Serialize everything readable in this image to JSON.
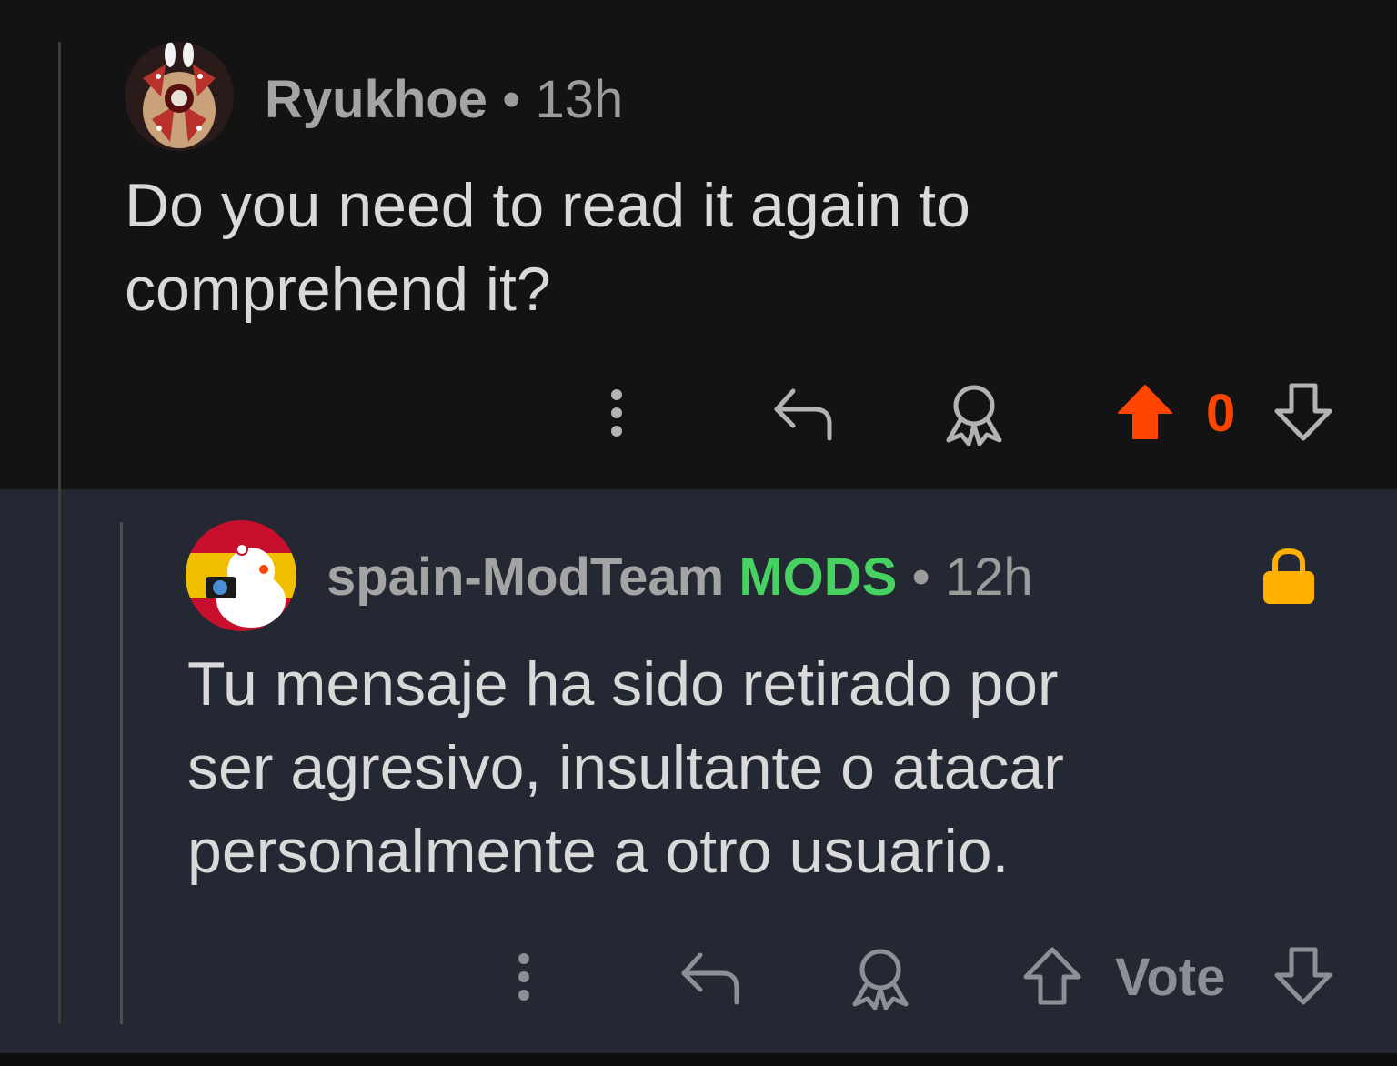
{
  "comment": {
    "author": "Ryukhoe",
    "separator": "•",
    "time": "13h",
    "text_line1": "Do you need to read it again to",
    "text_line2": "comprehend it?",
    "score": "0",
    "upvote_color": "#ff4500",
    "actions": [
      "more-options-icon",
      "reply-icon",
      "award-icon",
      "upvote-icon",
      "downvote-icon"
    ]
  },
  "reply": {
    "author": "spain-ModTeam",
    "flair": "MODS",
    "separator": "•",
    "time": "12h",
    "text_line1": "Tu mensaje ha sido retirado por",
    "text_line2": "ser agresivo, insultante o atacar",
    "text_line3": "personalmente a otro usuario.",
    "vote_label": "Vote",
    "lock_color": "#ffb000",
    "flair_color": "#46d160",
    "actions": [
      "more-options-icon",
      "reply-icon",
      "award-icon",
      "upvote-icon",
      "downvote-icon",
      "lock-icon"
    ]
  }
}
